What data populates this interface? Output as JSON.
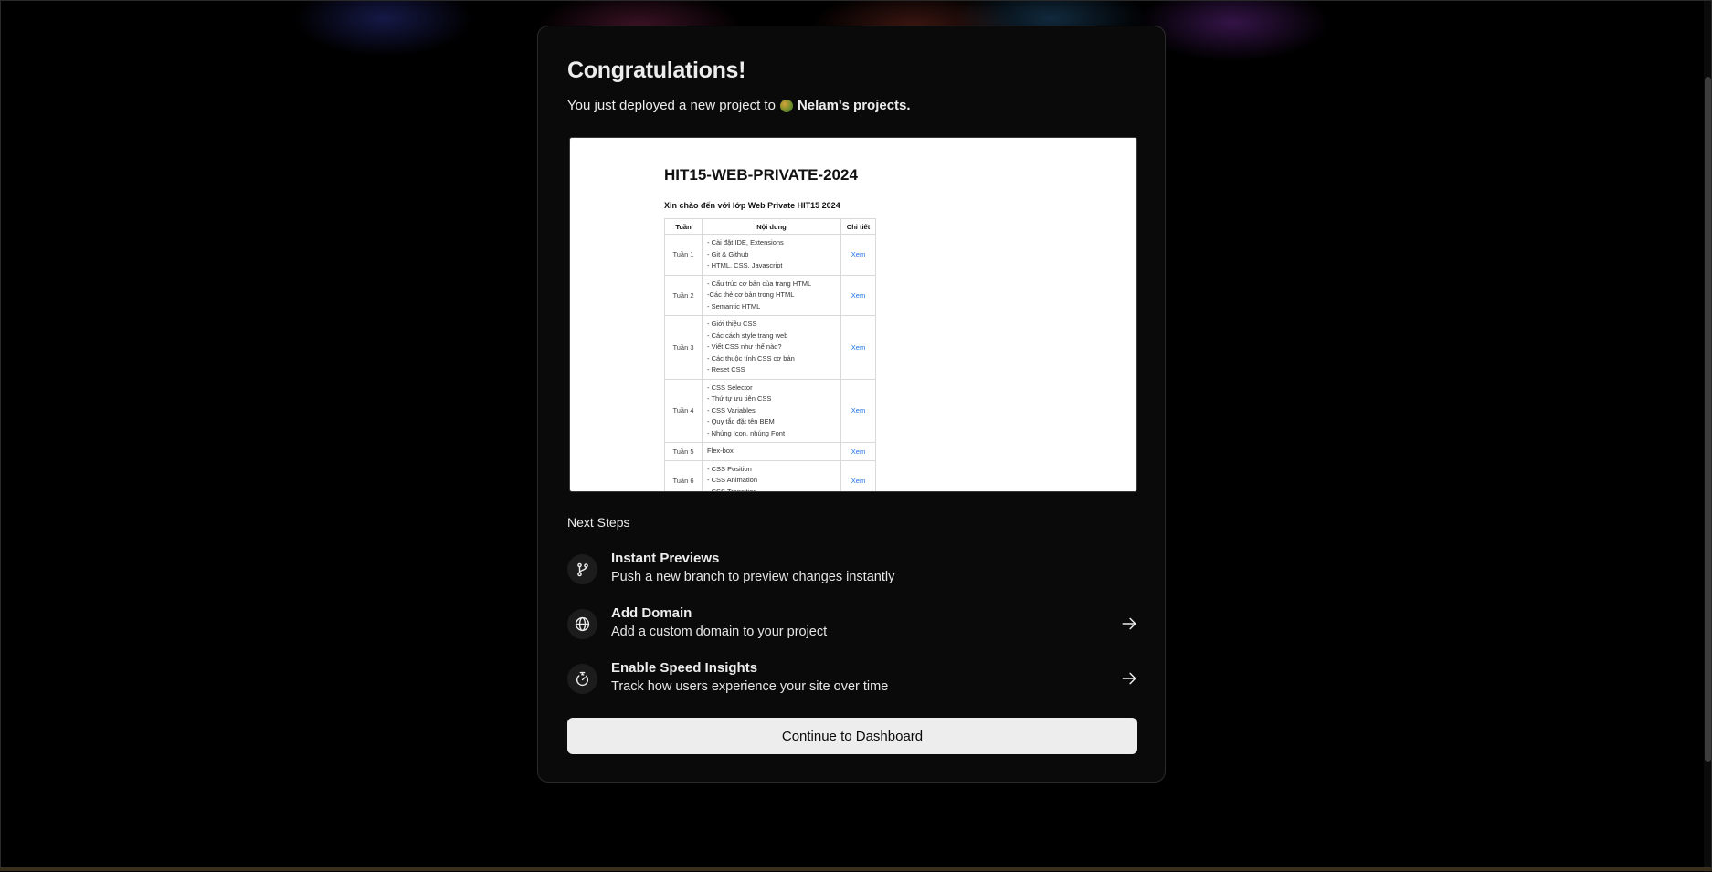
{
  "header": {
    "title": "Congratulations!",
    "subtitle_prefix": "You just deployed a new project to",
    "team_name": "Nelam's projects."
  },
  "preview": {
    "title": "HIT15-WEB-PRIVATE-2024",
    "subtitle": "Xin chào đến với lớp Web Private HIT15 2024",
    "columns": [
      "Tuần",
      "Nội dung",
      "Chi tiết"
    ],
    "rows": [
      {
        "week": "Tuần 1",
        "lines": [
          "- Cài đặt IDE, Extensions",
          "- Git & Github",
          "- HTML, CSS, Javascript"
        ],
        "link": "Xem"
      },
      {
        "week": "Tuần 2",
        "lines": [
          "- Cấu trúc cơ bản của trang HTML",
          "-Các thẻ cơ bản trong HTML",
          "- Semantic HTML"
        ],
        "link": "Xem"
      },
      {
        "week": "Tuần 3",
        "lines": [
          "- Giới thiệu CSS",
          "- Các cách style trang web",
          "- Viết CSS như thế nào?",
          "- Các thuộc tính CSS cơ bản",
          "- Reset CSS"
        ],
        "link": "Xem"
      },
      {
        "week": "Tuần 4",
        "lines": [
          "- CSS Selector",
          "- Thứ tự ưu tiên CSS",
          "- CSS Variables",
          "- Quy tắc đặt tên BEM",
          "- Nhúng Icon, nhúng Font"
        ],
        "link": "Xem"
      },
      {
        "week": "Tuần 5",
        "lines": [
          "Flex-box"
        ],
        "link": "Xem"
      },
      {
        "week": "Tuần 6",
        "lines": [
          "- CSS Position",
          "- CSS Animation",
          "- CSS Transition"
        ],
        "link": "Xem"
      }
    ]
  },
  "next_steps": {
    "title": "Next Steps",
    "items": [
      {
        "title": "Instant Previews",
        "description": "Push a new branch to preview changes instantly",
        "icon": "git-branch-icon",
        "has_arrow": false
      },
      {
        "title": "Add Domain",
        "description": "Add a custom domain to your project",
        "icon": "globe-icon",
        "has_arrow": true
      },
      {
        "title": "Enable Speed Insights",
        "description": "Track how users experience your site over time",
        "icon": "stopwatch-icon",
        "has_arrow": true
      }
    ]
  },
  "continue_button": "Continue to Dashboard",
  "colors": {
    "background": "#000000",
    "card": "#0a0a0a",
    "button_bg": "#ededed",
    "link": "#1a73e8"
  }
}
